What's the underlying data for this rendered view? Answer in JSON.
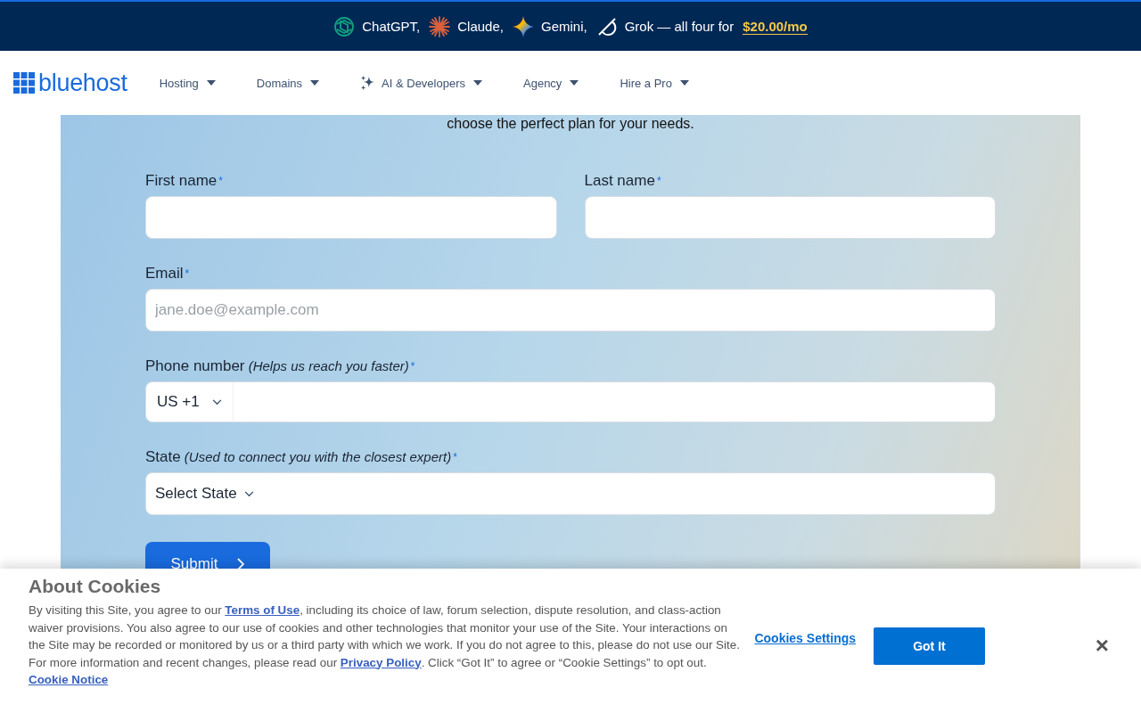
{
  "promo": {
    "items": [
      {
        "kind": "knot",
        "label": "ChatGPT,"
      },
      {
        "kind": "burst",
        "label": "Claude,"
      },
      {
        "kind": "sparkle",
        "label": "Gemini,"
      },
      {
        "kind": "slash",
        "label": "Grok — all four for"
      }
    ],
    "price": "$20.00/mo"
  },
  "nav": {
    "logo": "bluehost",
    "items": [
      {
        "label": "Hosting",
        "icon": false
      },
      {
        "label": "Domains",
        "icon": false
      },
      {
        "label": "AI & Developers",
        "icon": true
      },
      {
        "label": "Agency",
        "icon": false
      },
      {
        "label": "Hire a Pro",
        "icon": false
      }
    ]
  },
  "intro": "choose the perfect plan for your needs.",
  "form": {
    "rows": [
      [
        {
          "kind": "text",
          "label": "First name",
          "required": true
        },
        {
          "kind": "text",
          "label": "Last name",
          "required": true
        }
      ],
      [
        {
          "kind": "text",
          "label": "Email",
          "placeholder": "jane.doe@example.com",
          "required": true
        }
      ],
      [
        {
          "kind": "phone",
          "label": "Phone number",
          "hint": "(Helps us reach you faster)",
          "value": "US +1",
          "required": true
        }
      ],
      [
        {
          "kind": "select",
          "label": "State",
          "hint": "(Used to connect you with the closest expert)",
          "value": "Select State",
          "required": true
        }
      ]
    ],
    "submit": "Submit",
    "required_mark": "*"
  },
  "cookies": {
    "title": "About Cookies",
    "body": [
      {
        "kind": "text",
        "text": "By visiting this Site, you agree to our "
      },
      {
        "kind": "link",
        "text": "Terms of Use"
      },
      {
        "kind": "text",
        "text": ", including its choice of law, forum selection, dispute resolution, and class-action waiver provisions. You also agree to our use of cookies and other technologies that monitor your use of the Site. Your interactions on the Site may be recorded or monitored by us or a third party with which we work. If you do not agree to this, please do not use our Site. For more information and recent changes, please read our "
      },
      {
        "kind": "link",
        "text": "Privacy Policy"
      },
      {
        "kind": "text",
        "text": ". Click “Got It” to agree or “Cookie Settings” to opt out."
      }
    ],
    "notice": "Cookie Notice",
    "settings": "Cookies Settings",
    "accept": "Got It",
    "close": "×"
  }
}
